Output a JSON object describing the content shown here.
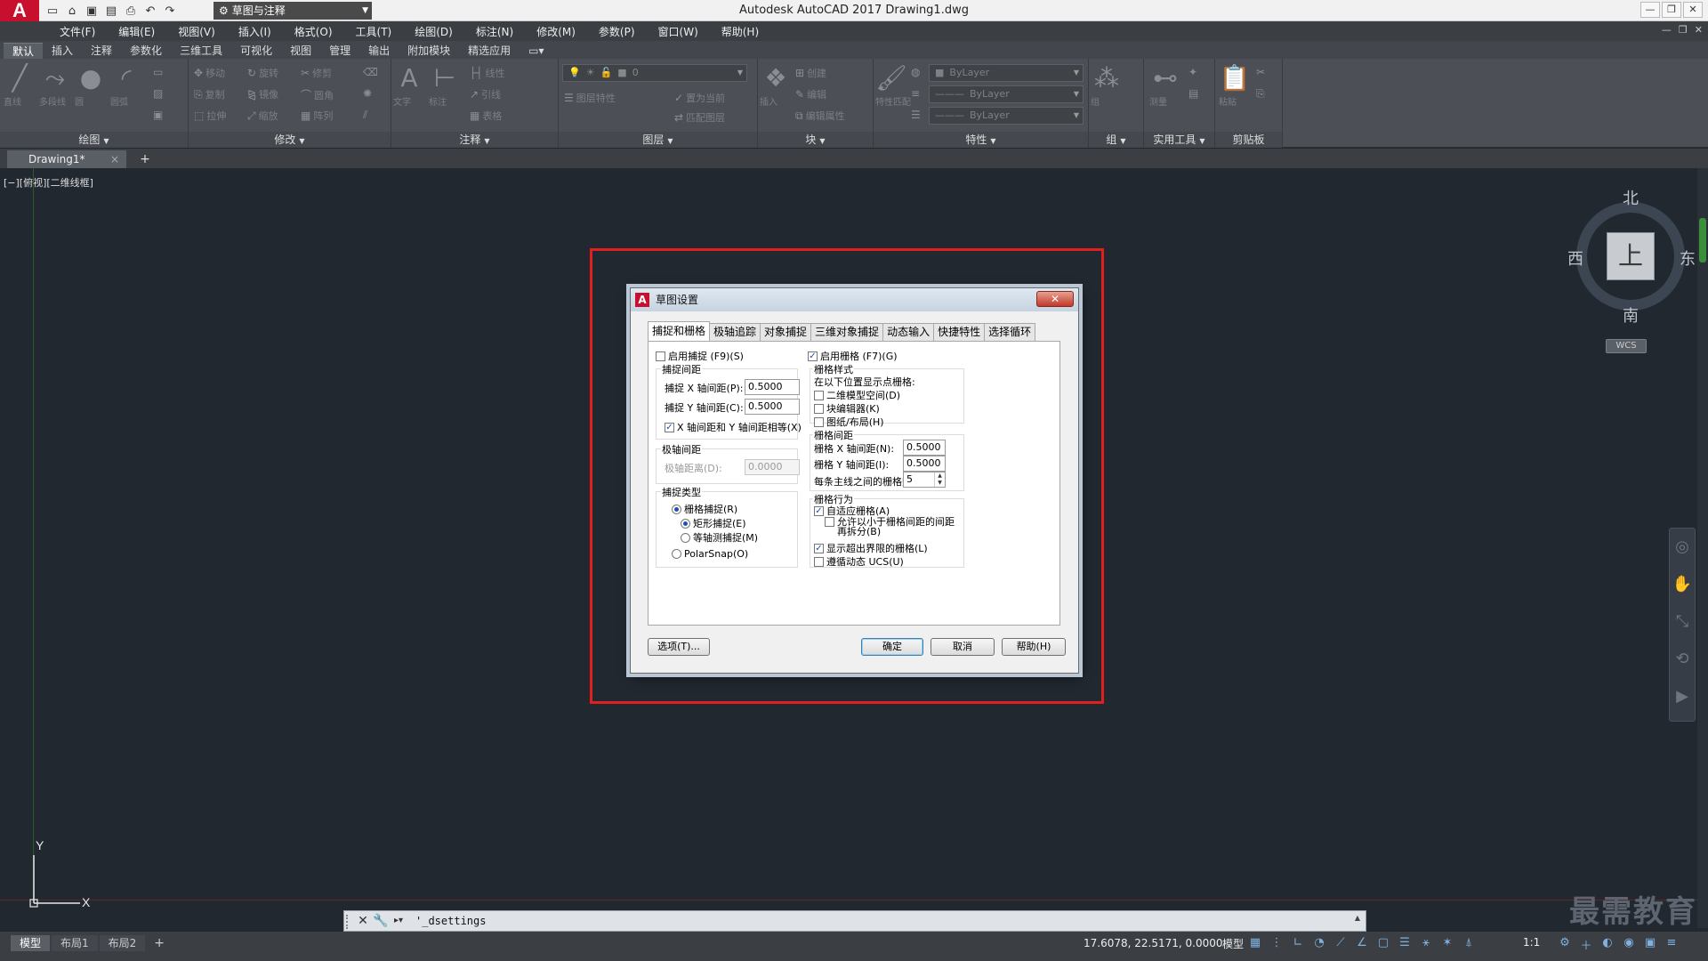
{
  "app": {
    "logo_letter": "A",
    "title": "Autodesk AutoCAD 2017    Drawing1.dwg",
    "workspace": "草图与注释"
  },
  "menu": [
    "文件(F)",
    "编辑(E)",
    "视图(V)",
    "插入(I)",
    "格式(O)",
    "工具(T)",
    "绘图(D)",
    "标注(N)",
    "修改(M)",
    "参数(P)",
    "窗口(W)",
    "帮助(H)"
  ],
  "ribbon_tabs": [
    "默认",
    "插入",
    "注释",
    "参数化",
    "三维工具",
    "可视化",
    "视图",
    "管理",
    "输出",
    "附加模块",
    "精选应用"
  ],
  "ribbon": {
    "draw": {
      "title": "绘图",
      "tools": [
        "直线",
        "多段线",
        "圆",
        "圆弧"
      ]
    },
    "modify": {
      "title": "修改",
      "tools": [
        "移动",
        "旋转",
        "修剪",
        "复制",
        "镜像",
        "圆角",
        "拉伸",
        "缩放",
        "阵列"
      ]
    },
    "annotate": {
      "title": "注释",
      "tools": [
        "文字",
        "标注",
        "线性",
        "引线",
        "表格"
      ]
    },
    "layers": {
      "title": "图层",
      "layer_value": "0",
      "tools": [
        "图层特性",
        "置为当前",
        "匹配图层"
      ]
    },
    "block": {
      "title": "块",
      "tools": [
        "插入",
        "创建",
        "编辑",
        "编辑属性"
      ]
    },
    "properties": {
      "title": "特性",
      "match_label": "特性匹配",
      "color": "ByLayer",
      "linetype": "ByLayer",
      "lineweight": "ByLayer"
    },
    "groups": {
      "title": "组",
      "tool": "组"
    },
    "utilities": {
      "title": "实用工具",
      "tool": "测量"
    },
    "clipboard": {
      "title": "剪贴板",
      "tool": "粘贴"
    }
  },
  "file_tab": {
    "name": "Drawing1*",
    "close": "×",
    "add": "+"
  },
  "viewport_label": "[−][俯视][二维线框]",
  "viewcube": {
    "north": "北",
    "south": "南",
    "west": "西",
    "east": "东",
    "face": "上",
    "wcs": "WCS"
  },
  "ucs": {
    "x": "X",
    "y": "Y"
  },
  "watermark": "最需教育",
  "dialog": {
    "title": "草图设置",
    "close": "✕",
    "tabs": [
      "捕捉和栅格",
      "极轴追踪",
      "对象捕捉",
      "三维对象捕捉",
      "动态输入",
      "快捷特性",
      "选择循环"
    ],
    "snap_on": {
      "label": "启用捕捉 (F9)(S)",
      "checked": false
    },
    "grid_on": {
      "label": "启用栅格 (F7)(G)",
      "checked": true
    },
    "snap_spacing": {
      "title": "捕捉间距",
      "x_label": "捕捉 X 轴间距(P):",
      "x_value": "0.5000",
      "y_label": "捕捉 Y 轴间距(C):",
      "y_value": "0.5000",
      "equal_label": "X 轴间距和 Y 轴间距相等(X)",
      "equal_checked": true
    },
    "polar_spacing": {
      "title": "极轴间距",
      "label": "极轴距离(D):",
      "value": "0.0000"
    },
    "snap_type": {
      "title": "捕捉类型",
      "grid_snap": "栅格捕捉(R)",
      "rect_snap": "矩形捕捉(E)",
      "iso_snap": "等轴测捕捉(M)",
      "polar_snap": "PolarSnap(O)"
    },
    "grid_style": {
      "title": "栅格样式",
      "subtitle": "在以下位置显示点栅格:",
      "items": [
        "二维模型空间(D)",
        "块编辑器(K)",
        "图纸/布局(H)"
      ]
    },
    "grid_spacing": {
      "title": "栅格间距",
      "x_label": "栅格 X 轴间距(N):",
      "x_value": "0.5000",
      "y_label": "栅格 Y 轴间距(I):",
      "y_value": "0.5000",
      "major_label": "每条主线之间的栅格数(J):",
      "major_value": "5"
    },
    "grid_behavior": {
      "title": "栅格行为",
      "adaptive": "自适应栅格(A)",
      "subdivide": "允许以小于栅格间距的间距再拆分(B)",
      "beyond": "显示超出界限的栅格(L)",
      "follow_ucs": "遵循动态 UCS(U)"
    },
    "buttons": {
      "options": "选项(T)...",
      "ok": "确定",
      "cancel": "取消",
      "help": "帮助(H)"
    }
  },
  "command_line": {
    "text": "'_dsettings"
  },
  "status": {
    "layouts": [
      "模型",
      "布局1",
      "布局2"
    ],
    "add": "+",
    "coords": "17.6078, 22.5171, 0.0000",
    "mode": "模型",
    "scale": "1:1"
  }
}
